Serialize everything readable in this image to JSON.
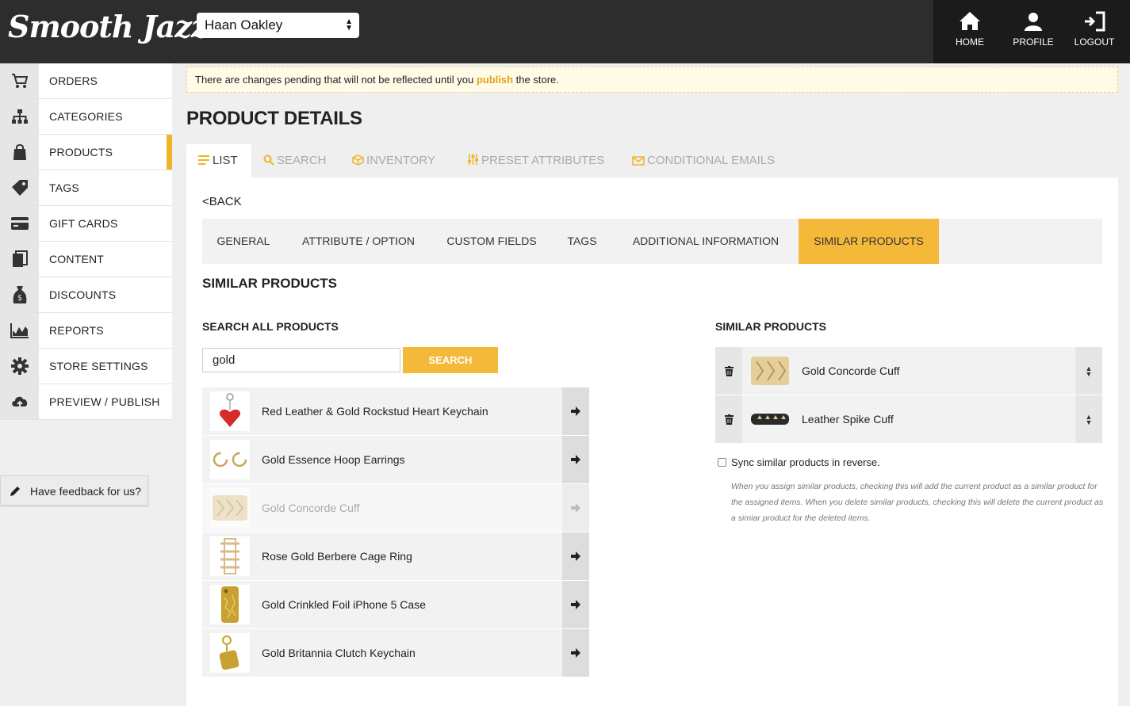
{
  "header": {
    "logo_text": "Smooth Jazz",
    "logo_mark": "®",
    "store_select": "Haan Oakley",
    "nav": [
      {
        "label": "HOME",
        "icon": "home-icon"
      },
      {
        "label": "PROFILE",
        "icon": "profile-icon"
      },
      {
        "label": "LOGOUT",
        "icon": "logout-icon"
      }
    ]
  },
  "sidebar": {
    "items": [
      {
        "label": "ORDERS",
        "icon": "cart-icon"
      },
      {
        "label": "CATEGORIES",
        "icon": "sitemap-icon"
      },
      {
        "label": "PRODUCTS",
        "icon": "shopping-bag-icon",
        "active": true
      },
      {
        "label": "TAGS",
        "icon": "tag-icon"
      },
      {
        "label": "GIFT CARDS",
        "icon": "credit-card-icon"
      },
      {
        "label": "CONTENT",
        "icon": "pages-icon"
      },
      {
        "label": "DISCOUNTS",
        "icon": "money-bag-icon"
      },
      {
        "label": "REPORTS",
        "icon": "chart-icon"
      },
      {
        "label": "STORE SETTINGS",
        "icon": "gear-icon"
      },
      {
        "label": "PREVIEW / PUBLISH",
        "icon": "cloud-upload-icon"
      }
    ],
    "feedback_label": "Have feedback for us?"
  },
  "notice": {
    "before": "There are changes pending that will not be reflected until you ",
    "link": "publish",
    "after": " the store."
  },
  "page": {
    "title": "PRODUCT DETAILS",
    "tabs": [
      {
        "label": "LIST",
        "icon": "list-icon",
        "active": true
      },
      {
        "label": "SEARCH",
        "icon": "search-icon"
      },
      {
        "label": "INVENTORY",
        "icon": "box-icon"
      },
      {
        "label": "PRESET ATTRIBUTES",
        "icon": "sliders-icon"
      },
      {
        "label": "CONDITIONAL EMAILS",
        "icon": "envelope-icon"
      }
    ],
    "back_label": "<BACK",
    "subtabs": [
      {
        "label": "GENERAL"
      },
      {
        "label": "ATTRIBUTE / OPTION"
      },
      {
        "label": "CUSTOM FIELDS"
      },
      {
        "label": "TAGS"
      },
      {
        "label": "ADDITIONAL INFORMATION"
      },
      {
        "label": "SIMILAR PRODUCTS",
        "active": true
      }
    ],
    "section_title": "SIMILAR PRODUCTS"
  },
  "search": {
    "heading": "SEARCH ALL PRODUCTS",
    "query": "gold",
    "button_label": "SEARCH",
    "results": [
      {
        "name": "Red Leather & Gold Rockstud Heart Keychain",
        "thumb": "heart-keychain"
      },
      {
        "name": "Gold Essence Hoop Earrings",
        "thumb": "hoop-earrings"
      },
      {
        "name": "Gold Concorde Cuff",
        "thumb": "concorde-cuff",
        "disabled": true
      },
      {
        "name": "Rose Gold Berbere Cage Ring",
        "thumb": "cage-ring"
      },
      {
        "name": "Gold Crinkled Foil iPhone 5 Case",
        "thumb": "iphone-case"
      },
      {
        "name": "Gold Britannia Clutch Keychain",
        "thumb": "clutch-keychain"
      }
    ]
  },
  "similar": {
    "heading": "SIMILAR PRODUCTS",
    "items": [
      {
        "name": "Gold Concorde Cuff",
        "thumb": "concorde-cuff"
      },
      {
        "name": "Leather Spike Cuff",
        "thumb": "spike-cuff"
      }
    ],
    "sync_label": "Sync similar products in reverse.",
    "sync_checked": false,
    "sync_help": "When you assign similar products, checking this will add the current product as a similar product for the assigned items. When you delete similar products, checking this will delete the current product as a simiar product for the deleted items."
  },
  "colors": {
    "accent": "#f5b93a",
    "topbar": "#2d2d2d",
    "topnav": "#1b1b1b"
  }
}
